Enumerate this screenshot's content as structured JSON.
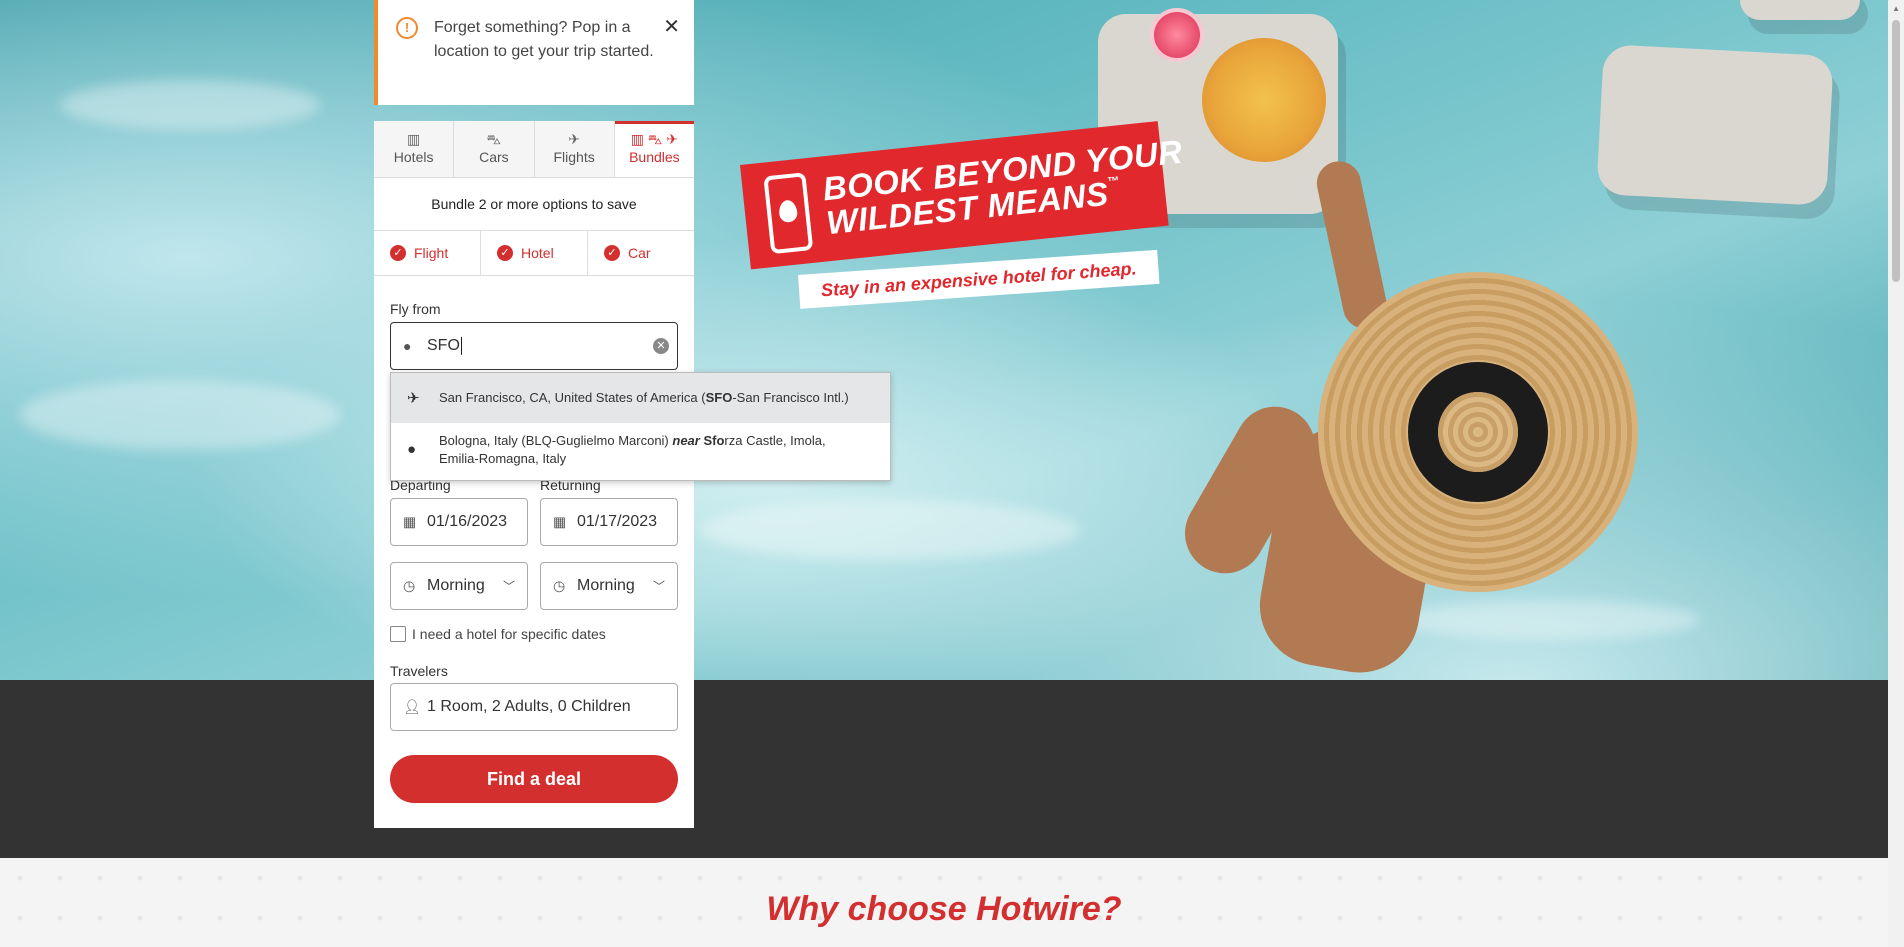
{
  "alert": {
    "icon": "exclamation-circle-icon",
    "message": "Forget something? Pop in a location to get your trip started.",
    "close_icon": "close-icon"
  },
  "tabs": [
    {
      "label": "Hotels",
      "icon": "hotel-icon"
    },
    {
      "label": "Cars",
      "icon": "car-icon"
    },
    {
      "label": "Flights",
      "icon": "plane-icon"
    },
    {
      "label": "Bundles",
      "icon": "bundle-icon",
      "active": true
    }
  ],
  "bundle_hint": "Bundle 2 or more options to save",
  "bundle_options": [
    {
      "label": "Flight",
      "checked": true
    },
    {
      "label": "Hotel",
      "checked": true
    },
    {
      "label": "Car",
      "checked": true
    }
  ],
  "fly_from": {
    "label": "Fly from",
    "value": "SFO",
    "icon": "location-pin-icon"
  },
  "suggestions": [
    {
      "icon": "plane-icon",
      "text_before": "San Francisco, CA, United States of America (",
      "bold": "SFO",
      "text_after": "-San Francisco Intl.)"
    },
    {
      "icon": "location-pin-icon",
      "text_before": "Bologna, Italy (BLQ-Guglielmo Marconi) ",
      "near": "near",
      "bold": "Sfo",
      "text_after": "rza Castle, Imola, Emilia-Romagna, Italy"
    }
  ],
  "departing": {
    "label": "Departing",
    "value": "01/16/2023",
    "time": "Morning"
  },
  "returning": {
    "label": "Returning",
    "value": "01/17/2023",
    "time": "Morning"
  },
  "hotel_dates_checkbox": {
    "label": "I need a hotel for specific dates",
    "checked": false
  },
  "travelers": {
    "label": "Travelers",
    "value": "1 Room, 2 Adults, 0 Children"
  },
  "find_button": "Find a deal",
  "promo": {
    "line1": "BOOK BEYOND YOUR",
    "line2": "WILDEST MEANS",
    "tm": "™",
    "tagline": "Stay in an expensive hotel for cheap."
  },
  "why_heading": "Why choose Hotwire?",
  "colors": {
    "brand": "#d32f2f",
    "alert_accent": "#f08a2c"
  }
}
